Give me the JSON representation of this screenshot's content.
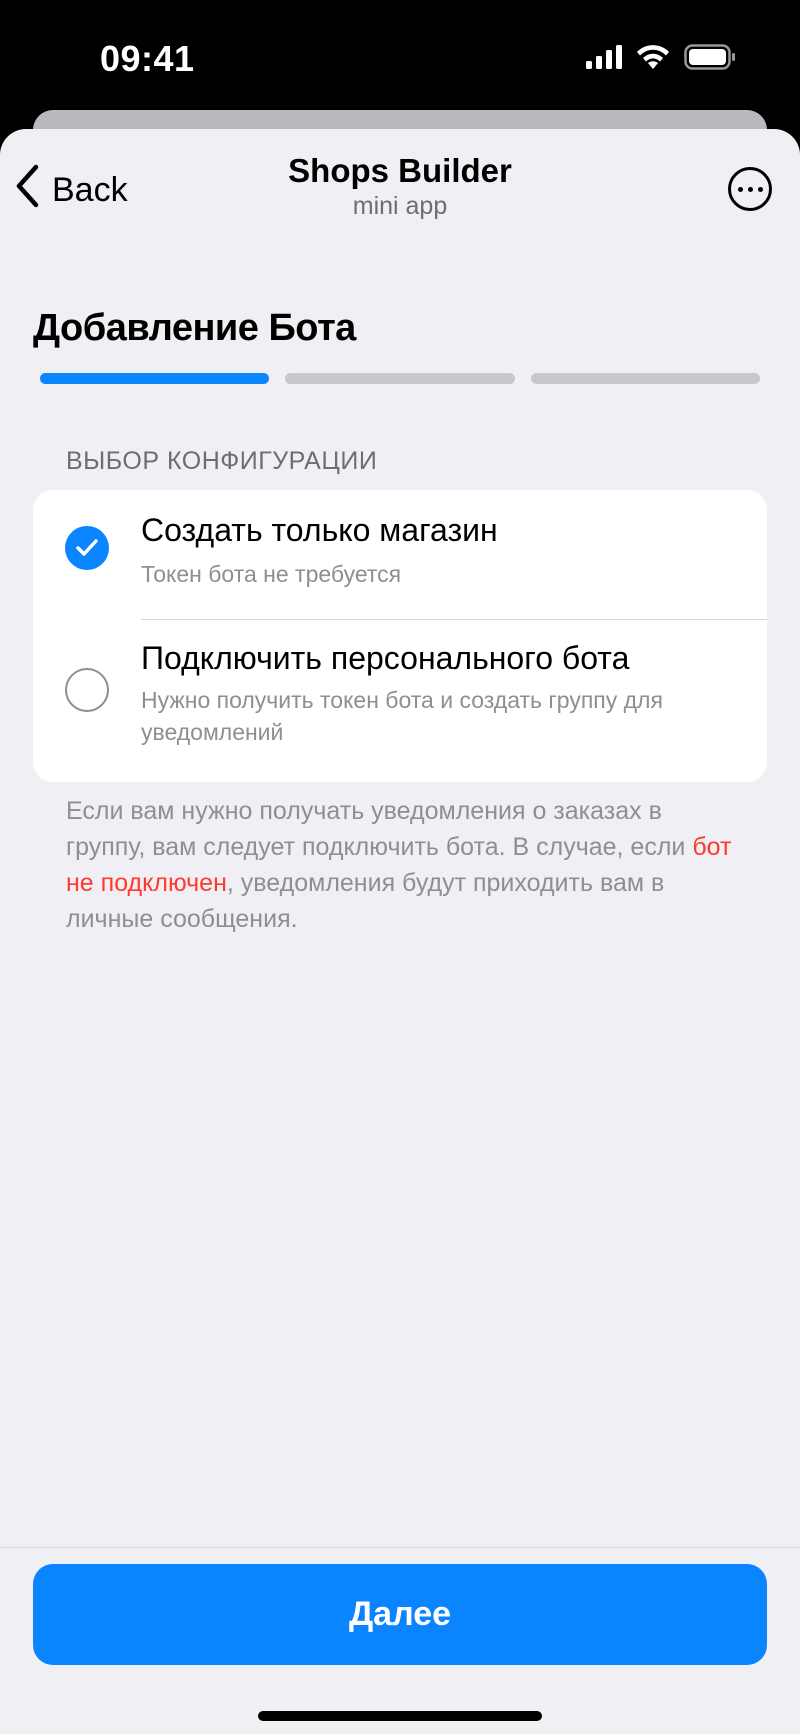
{
  "status_bar": {
    "time": "09:41",
    "icons": [
      "signal-icon",
      "wifi-icon",
      "battery-icon"
    ]
  },
  "nav": {
    "back_label": "Back",
    "title": "Shops Builder",
    "subtitle": "mini app",
    "more_icon": "ellipsis-circle-icon"
  },
  "page": {
    "title": "Добавление Бота",
    "steps": [
      {
        "state": "active"
      },
      {
        "state": "inactive"
      },
      {
        "state": "inactive"
      }
    ]
  },
  "config": {
    "section_header": "ВЫБОР КОНФИГУРАЦИИ",
    "options": [
      {
        "title": "Создать только магазин",
        "description": "Токен бота не требуется",
        "selected": true
      },
      {
        "title": "Подключить персонального бота",
        "description": "Нужно получить токен бота и создать группу для уведомлений",
        "selected": false
      }
    ],
    "note": {
      "before": "Если вам нужно получать уведомления о заказах в группу, вам следует подключить бота. В случае, если ",
      "highlight": "бот не подключен",
      "after": ", уведомления будут приходить вам в личные сообщения."
    }
  },
  "footer": {
    "next_label": "Далее"
  },
  "colors": {
    "accent": "#0a84ff",
    "warning": "#ff3b30",
    "background": "#efeff4",
    "card": "#ffffff",
    "secondary_text": "#8e8e93"
  }
}
